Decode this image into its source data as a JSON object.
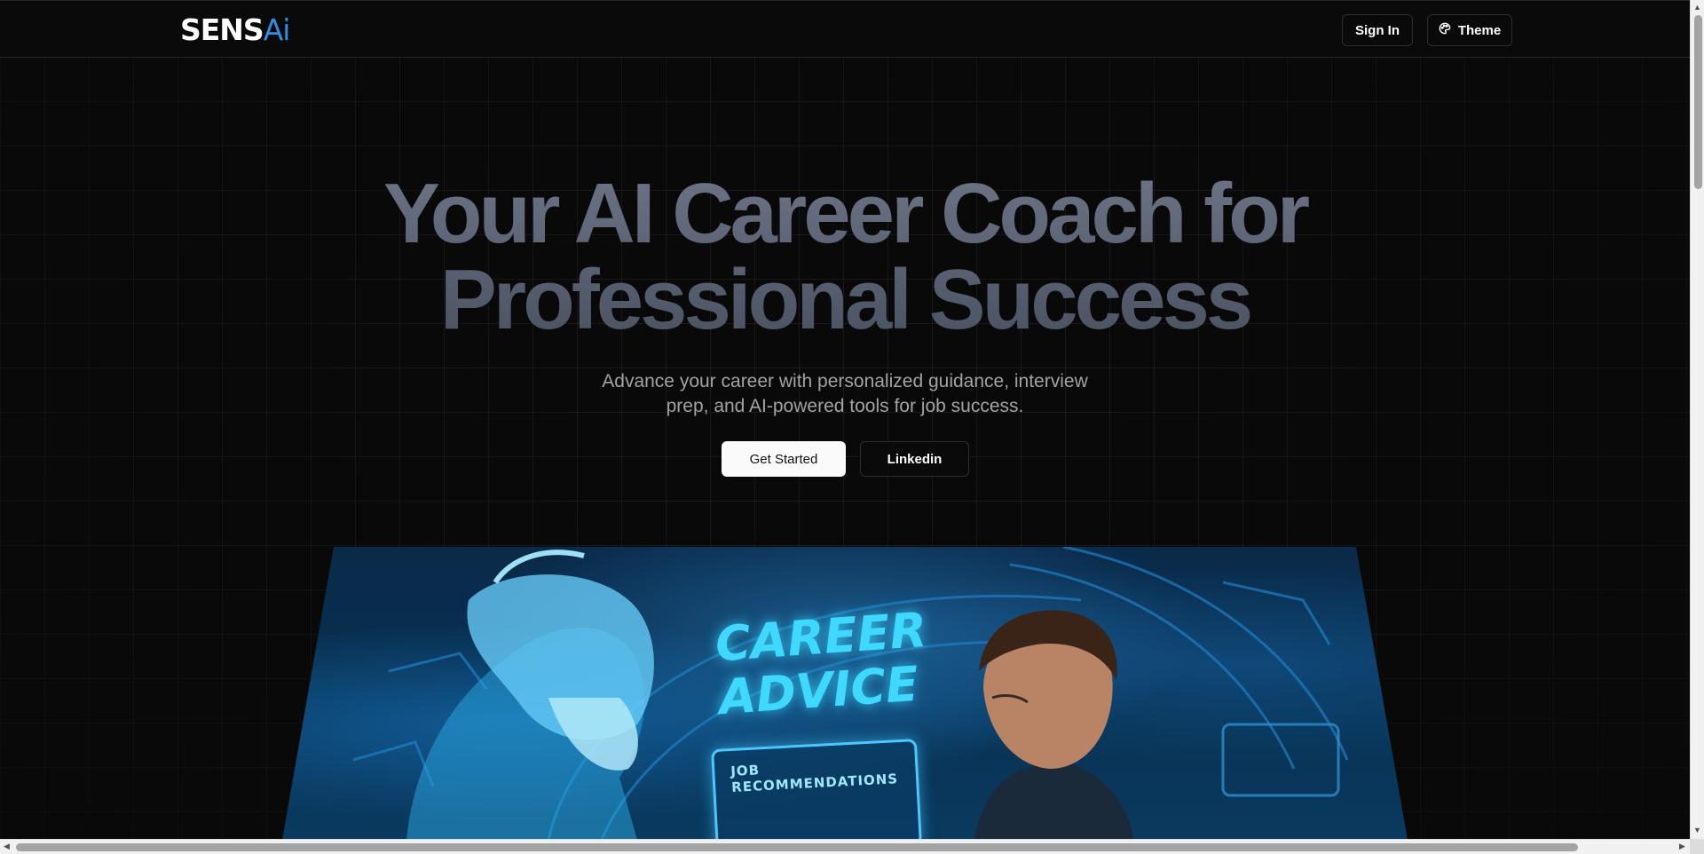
{
  "brand": {
    "logo_primary": "SENS",
    "logo_accent": "Ai",
    "accent_color": "#2f8fe0"
  },
  "nav": {
    "sign_in_label": "Sign In",
    "theme_label": "Theme",
    "theme_icon": "palette-icon"
  },
  "hero": {
    "title_line1": "Your AI Career Coach for",
    "title_line2": "Professional Success",
    "subtitle": "Advance your career with personalized guidance, interview prep, and AI-powered tools for job success.",
    "primary_button": "Get Started",
    "secondary_button": "Linkedin"
  },
  "hero_image": {
    "headline_line1": "CAREER",
    "headline_line2": "ADVICE",
    "panel_label": "JOB RECOMMENDATIONS",
    "glow_color": "#3fd9ff"
  }
}
